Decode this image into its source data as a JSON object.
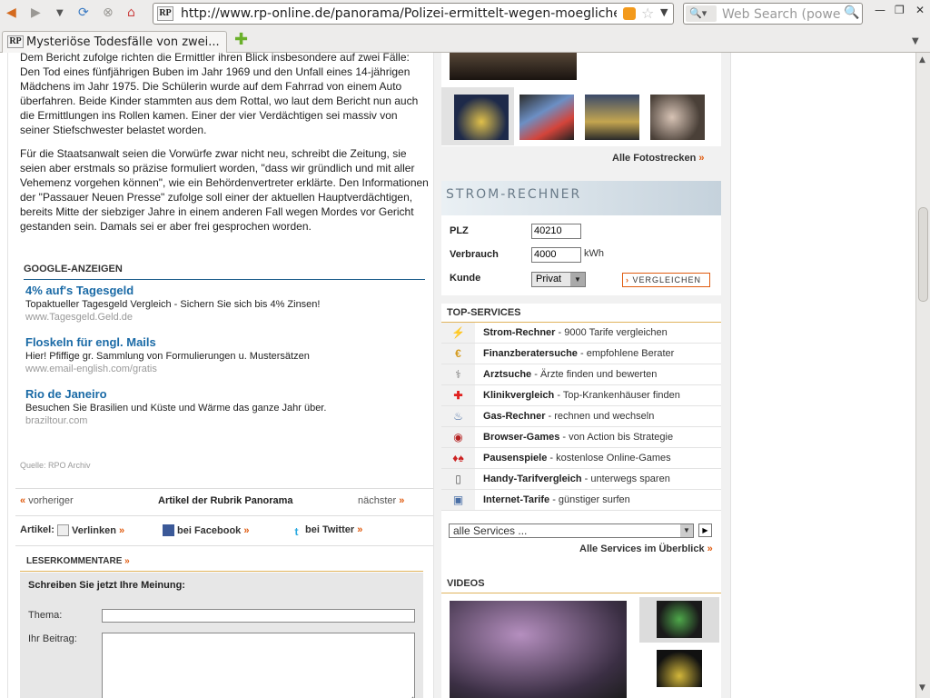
{
  "browser": {
    "url": "http://www.rp-online.de/panorama/Polizei-ermittelt-wegen-moeglicher-Sat",
    "search_placeholder": "Web Search (powered",
    "favicon_text": "RP",
    "tab_title": "Mysteriöse Todesfälle von zwei..."
  },
  "article": {
    "p1": "Dem Bericht zufolge richten die Ermittler ihren Blick insbesondere auf zwei Fälle: Den Tod eines fünfjährigen Buben im Jahr 1969 und den Unfall eines 14-jährigen Mädchens im Jahr 1975. Die Schülerin wurde auf dem Fahrrad von einem Auto überfahren. Beide Kinder stammten aus dem Rottal, wo laut dem Bericht nun auch die Ermittlungen ins Rollen kamen. Einer der vier Verdächtigen sei massiv von seiner Stiefschwester belastet worden.",
    "p2": "Für die Staatsanwalt seien die Vorwürfe zwar nicht neu, schreibt die Zeitung, sie seien aber erstmals so präzise formuliert worden, \"dass wir gründlich und mit aller Vehemenz vorgehen können\", wie ein Behördenvertreter erklärte. Den Informationen der \"Passauer Neuen Presse\" zufolge soll einer der aktuellen Hauptverdächtigen, bereits Mitte der siebziger Jahre in einem anderen Fall wegen Mordes vor Gericht gestanden sein. Damals sei er aber frei gesprochen worden.",
    "source": "Quelle: RPO Archiv"
  },
  "ads": {
    "title": "GOOGLE-ANZEIGEN",
    "items": [
      {
        "headline": "4% auf's Tagesgeld",
        "desc": "Topaktueller Tagesgeld Vergleich - Sichern Sie sich bis 4% Zinsen!",
        "url": "www.Tagesgeld.Geld.de"
      },
      {
        "headline": "Floskeln für engl. Mails",
        "desc": "Hier! Pfiffige gr. Sammlung von Formulierungen u. Mustersätzen",
        "url": "www.email-english.com/gratis"
      },
      {
        "headline": "Rio de Janeiro",
        "desc": "Besuchen Sie Brasilien und Küste und Wärme das ganze Jahr über.",
        "url": "braziltour.com"
      }
    ]
  },
  "nav": {
    "prev": "vorheriger",
    "center": "Artikel der Rubrik Panorama",
    "next": "nächster"
  },
  "share": {
    "label": "Artikel:",
    "link": "Verlinken",
    "facebook": "bei Facebook",
    "twitter": "bei Twitter"
  },
  "comments": {
    "title": "LESERKOMMENTARE",
    "form_title": "Schreiben Sie jetzt Ihre Meinung:",
    "subject_label": "Thema:",
    "body_label": "Ihr Beitrag:"
  },
  "photos": {
    "all_link": "Alle Fotostrecken"
  },
  "strom": {
    "banner": "STROM-RECHNER",
    "plz_label": "PLZ",
    "plz_value": "40210",
    "verbrauch_label": "Verbrauch",
    "verbrauch_value": "4000",
    "unit": "kWh",
    "kunde_label": "Kunde",
    "kunde_value": "Privat",
    "button": "VERGLEICHEN"
  },
  "services": {
    "title": "TOP-SERVICES",
    "items": [
      {
        "name": "Strom-Rechner",
        "desc": " - 9000 Tarife vergleichen",
        "icon": "power-pylon-icon"
      },
      {
        "name": "Finanzberatersuche",
        "desc": " - empfohlene Berater",
        "icon": "euro-icon"
      },
      {
        "name": "Arztsuche",
        "desc": " - Ärzte finden und bewerten",
        "icon": "doctor-icon"
      },
      {
        "name": "Klinikvergleich",
        "desc": " - Top-Krankenhäuser finden",
        "icon": "red-cross-icon"
      },
      {
        "name": "Gas-Rechner",
        "desc": " - rechnen und wechseln",
        "icon": "flame-icon"
      },
      {
        "name": "Browser-Games",
        "desc": " - von Action bis Strategie",
        "icon": "game-icon"
      },
      {
        "name": "Pausenspiele",
        "desc": " - kostenlose Online-Games",
        "icon": "cards-icon"
      },
      {
        "name": "Handy-Tarifvergleich",
        "desc": " - unterwegs sparen",
        "icon": "mobile-phone-icon"
      },
      {
        "name": "Internet-Tarife",
        "desc": " - günstiger surfen",
        "icon": "computer-icon"
      }
    ],
    "select": "alle Services ...",
    "overview": "Alle Services im Überblick"
  },
  "videos": {
    "title": "VIDEOS"
  }
}
